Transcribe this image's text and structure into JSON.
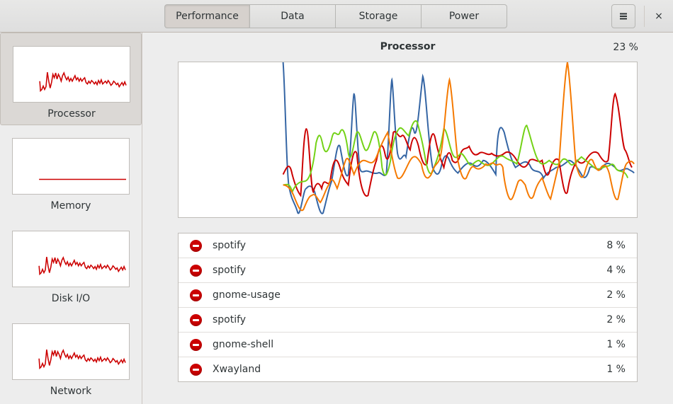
{
  "header": {
    "tabs": [
      {
        "label": "Performance",
        "active": true
      },
      {
        "label": "Data",
        "active": false
      },
      {
        "label": "Storage",
        "active": false
      },
      {
        "label": "Power",
        "active": false
      }
    ],
    "menu_icon": "hamburger-menu-icon",
    "close_label": "×"
  },
  "sidebar": {
    "items": [
      {
        "label": "Processor",
        "active": true
      },
      {
        "label": "Memory",
        "active": false
      },
      {
        "label": "Disk I/O",
        "active": false
      },
      {
        "label": "Network",
        "active": false
      }
    ]
  },
  "main": {
    "title": "Processor",
    "value": "23 %",
    "graph_colors": {
      "cpu1": "#3465a4",
      "cpu2": "#cc0000",
      "cpu3": "#73d216",
      "cpu4": "#f57900"
    },
    "processes": [
      {
        "name": "spotify",
        "percent": "8 %"
      },
      {
        "name": "spotify",
        "percent": "4 %"
      },
      {
        "name": "gnome-usage",
        "percent": "2 %"
      },
      {
        "name": "spotify",
        "percent": "2 %"
      },
      {
        "name": "gnome-shell",
        "percent": "1 %"
      },
      {
        "name": "Xwayland",
        "percent": "1 %"
      }
    ]
  }
}
